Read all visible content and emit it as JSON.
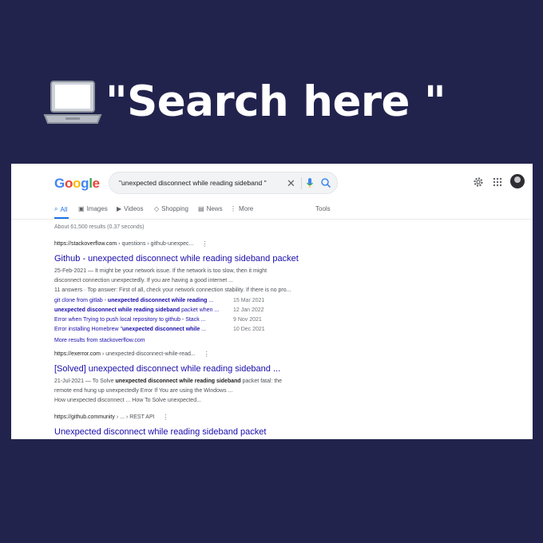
{
  "headline": "\"Search here \"",
  "google": {
    "logo_letters": [
      "G",
      "o",
      "o",
      "g",
      "l",
      "e"
    ],
    "logo_colors": [
      "#4285f4",
      "#ea4335",
      "#fbbc05",
      "#4285f4",
      "#34a853",
      "#ea4335"
    ],
    "query": "\"unexpected disconnect while reading sideband \"",
    "tabs": [
      {
        "label": "All",
        "icon": "search-icon",
        "active": true
      },
      {
        "label": "Images",
        "icon": "image-icon"
      },
      {
        "label": "Videos",
        "icon": "video-icon"
      },
      {
        "label": "Shopping",
        "icon": "tag-icon"
      },
      {
        "label": "News",
        "icon": "news-icon"
      },
      {
        "label": "More",
        "icon": "kebab-icon"
      },
      {
        "label": "Tools"
      }
    ],
    "stats": "About 61,500 results (0.37 seconds)",
    "results": [
      {
        "site": "https://stackoverflow.com",
        "crumb": " › questions › github-unexpec...",
        "title": "Github - unexpected disconnect while reading sideband packet",
        "snippet": [
          "25-Feb-2021 — It might be your network issue. If the network is too slow, then it might",
          "disconnect connection unexpectedly. If you are having a good internet ...",
          "11 answers · Top answer: First of all, check your network connection stability. If there is no pro..."
        ],
        "subresults": [
          {
            "pre": "git clone from gitlab - ",
            "bold": "unexpected disconnect while reading",
            "post": " ...",
            "date": "15 Mar 2021"
          },
          {
            "pre": "",
            "bold": "unexpected disconnect while reading sideband",
            "post": " packet when ...",
            "date": "12 Jan 2022"
          },
          {
            "pre": "Error when Trying to push local repository to github - Stack ...",
            "bold": "",
            "post": "",
            "date": "9 Nov 2021"
          },
          {
            "pre": "Error installing Homebrew \"",
            "bold": "unexpected disconnect while",
            "post": " ...",
            "date": "10 Dec 2021"
          }
        ],
        "more": "More results from stackoverflow.com"
      },
      {
        "site": "https://exerror.com",
        "crumb": " › unexpected-disconnect-while-read...",
        "title": "[Solved] unexpected disconnect while reading sideband ...",
        "snippet_date": "21-Jul-2021 — To Solve ",
        "snippet_bold": "unexpected disconnect while reading sideband",
        "snippet_rest": " packet fatal: the",
        "snippet_line2": "remote end hung up unexpectedly Error If You are using the Windows ...",
        "links": "How unexpected disconnect ...   How To Solve unexpected..."
      },
      {
        "site": "https://github.community",
        "crumb": " › ... › REST API",
        "title": "Unexpected disconnect while reading sideband packet"
      }
    ]
  }
}
